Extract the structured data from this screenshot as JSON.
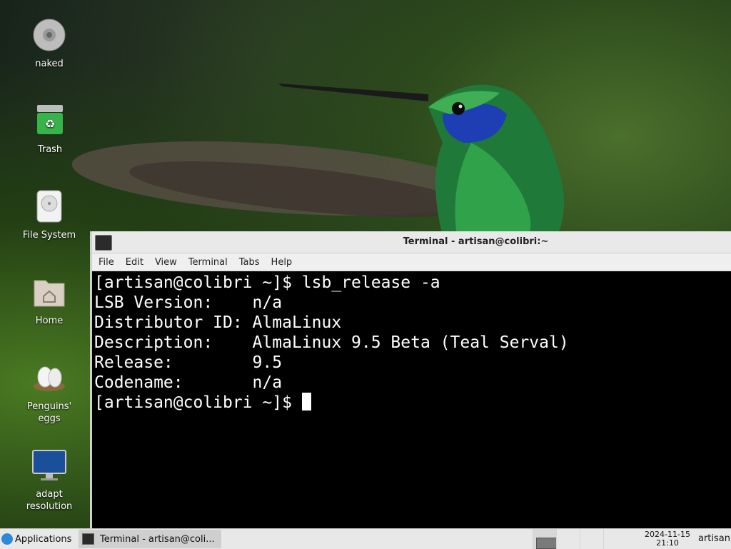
{
  "desktop": {
    "icons": [
      {
        "label": "naked",
        "icon": "optical-disc-icon"
      },
      {
        "label": "Trash",
        "icon": "trash-icon"
      },
      {
        "label": "File System",
        "icon": "hard-drive-icon"
      },
      {
        "label": "Home",
        "icon": "home-folder-icon"
      },
      {
        "label": "Penguins'\neggs",
        "icon": "eggs-icon"
      },
      {
        "label": "adapt\nresolution",
        "icon": "monitor-icon"
      }
    ]
  },
  "terminal": {
    "title": "Terminal - artisan@colibri:~",
    "menu": [
      "File",
      "Edit",
      "View",
      "Terminal",
      "Tabs",
      "Help"
    ],
    "lines": [
      "[artisan@colibri ~]$ lsb_release -a",
      "LSB Version:    n/a",
      "Distributor ID: AlmaLinux",
      "Description:    AlmaLinux 9.5 Beta (Teal Serval)",
      "Release:        9.5",
      "Codename:       n/a"
    ],
    "prompt": "[artisan@colibri ~]$ "
  },
  "taskbar": {
    "applications_label": "Applications",
    "task_label": "Terminal - artisan@coli...",
    "date": "2024-11-15",
    "time": "21:10",
    "user": "artisan"
  }
}
